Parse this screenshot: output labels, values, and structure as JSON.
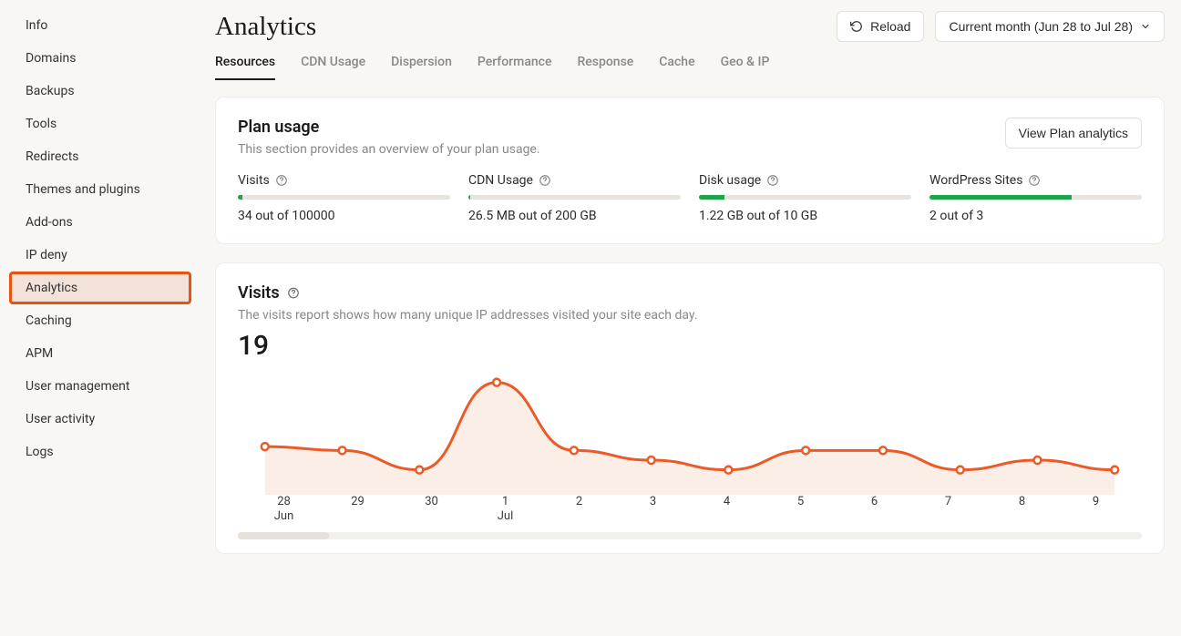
{
  "sidebar": {
    "items": [
      {
        "label": "Info",
        "active": false
      },
      {
        "label": "Domains",
        "active": false
      },
      {
        "label": "Backups",
        "active": false
      },
      {
        "label": "Tools",
        "active": false
      },
      {
        "label": "Redirects",
        "active": false
      },
      {
        "label": "Themes and plugins",
        "active": false
      },
      {
        "label": "Add-ons",
        "active": false
      },
      {
        "label": "IP deny",
        "active": false
      },
      {
        "label": "Analytics",
        "active": true
      },
      {
        "label": "Caching",
        "active": false
      },
      {
        "label": "APM",
        "active": false
      },
      {
        "label": "User management",
        "active": false
      },
      {
        "label": "User activity",
        "active": false
      },
      {
        "label": "Logs",
        "active": false
      }
    ]
  },
  "header": {
    "title": "Analytics",
    "reload_label": "Reload",
    "date_range_label": "Current month (Jun 28 to Jul 28)"
  },
  "tabs": [
    {
      "label": "Resources",
      "active": true
    },
    {
      "label": "CDN Usage",
      "active": false
    },
    {
      "label": "Dispersion",
      "active": false
    },
    {
      "label": "Performance",
      "active": false
    },
    {
      "label": "Response",
      "active": false
    },
    {
      "label": "Cache",
      "active": false
    },
    {
      "label": "Geo & IP",
      "active": false
    }
  ],
  "plan_usage": {
    "title": "Plan usage",
    "subtitle": "This section provides an overview of your plan usage.",
    "view_button": "View Plan analytics",
    "metrics": [
      {
        "label": "Visits",
        "value_text": "34 out of 100000",
        "percent": 2
      },
      {
        "label": "CDN Usage",
        "value_text": "26.5 MB out of 200 GB",
        "percent": 1
      },
      {
        "label": "Disk usage",
        "value_text": "1.22 GB out of 10 GB",
        "percent": 12
      },
      {
        "label": "WordPress Sites",
        "value_text": "2 out of 3",
        "percent": 67
      }
    ]
  },
  "visits": {
    "title": "Visits",
    "subtitle": "The visits report shows how many unique IP addresses visited your site each day.",
    "total": "19"
  },
  "chart_data": {
    "type": "line",
    "title": "Visits",
    "xlabel": "",
    "ylabel": "",
    "ylim": [
      0,
      6
    ],
    "x": [
      "28 Jun",
      "29",
      "30",
      "1 Jul",
      "2",
      "3",
      "4",
      "5",
      "6",
      "7",
      "8",
      "9"
    ],
    "values": [
      2.2,
      2.0,
      1.0,
      5.5,
      2.0,
      1.5,
      1.0,
      2.0,
      2.0,
      1.0,
      1.5,
      1.0
    ]
  },
  "colors": {
    "accent": "#e8530f",
    "line": "#ec5a27",
    "success": "#1fa44a"
  }
}
